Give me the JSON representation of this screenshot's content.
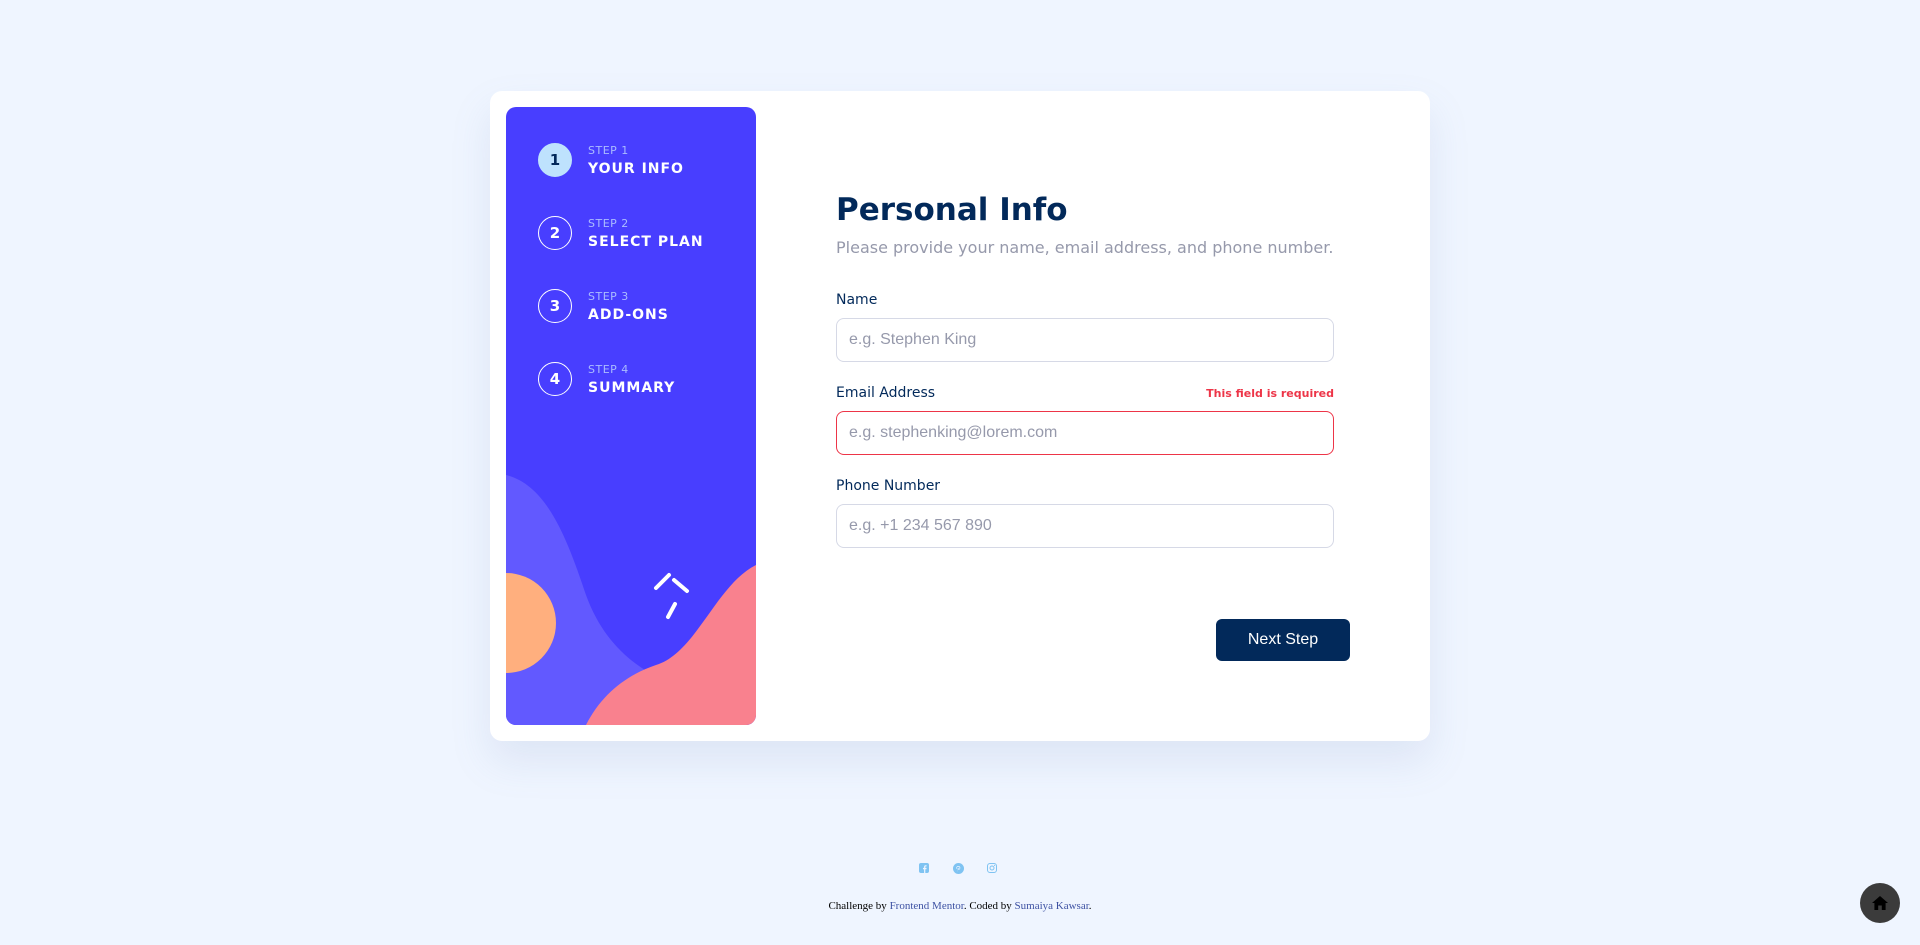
{
  "steps": [
    {
      "number": "1",
      "small": "STEP 1",
      "label": "YOUR INFO",
      "active": true
    },
    {
      "number": "2",
      "small": "STEP 2",
      "label": "SELECT PLAN",
      "active": false
    },
    {
      "number": "3",
      "small": "STEP 3",
      "label": "ADD-ONS",
      "active": false
    },
    {
      "number": "4",
      "small": "STEP 4",
      "label": "SUMMARY",
      "active": false
    }
  ],
  "form": {
    "title": "Personal Info",
    "subtitle": "Please provide your name, email address, and phone number.",
    "name": {
      "label": "Name",
      "placeholder": "e.g. Stephen King",
      "value": ""
    },
    "email": {
      "label": "Email Address",
      "placeholder": "e.g. stephenking@lorem.com",
      "value": "",
      "error": "This field is required"
    },
    "phone": {
      "label": "Phone Number",
      "placeholder": "e.g. +1 234 567 890",
      "value": ""
    },
    "next_label": "Next Step"
  },
  "footer": {
    "social_icons": [
      "facebook-icon",
      "pinterest-icon",
      "instagram-icon"
    ],
    "challenge_prefix": "Challenge by ",
    "challenge_link": "Frontend Mentor",
    "coded_prefix": ". Coded by ",
    "author_link": "Sumaiya Kawsar",
    "suffix": "."
  },
  "colors": {
    "sidebar": "#483eff",
    "marine_blue": "#02295a",
    "error_red": "#ed3548",
    "light_blue": "#bee2fd",
    "page_bg": "#eff5ff"
  }
}
